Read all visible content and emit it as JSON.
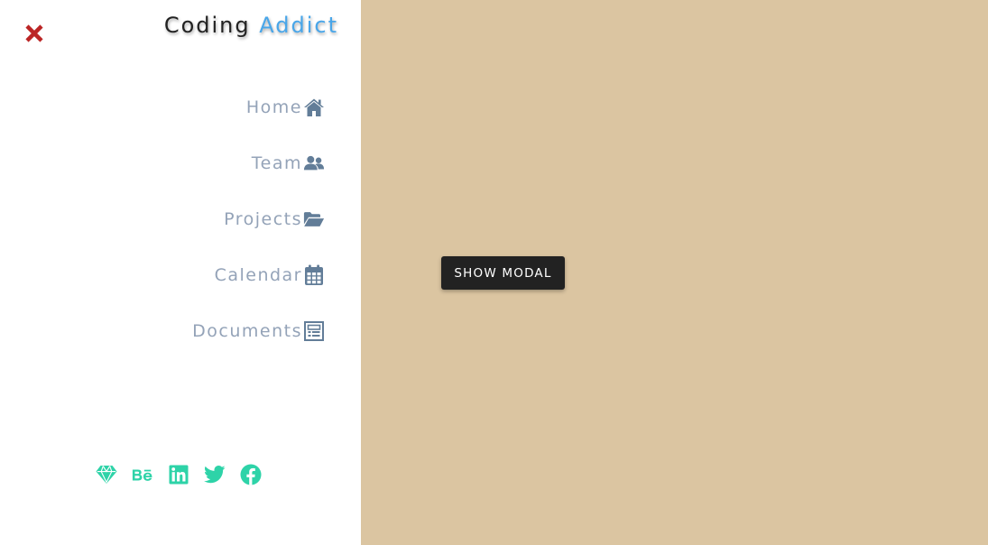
{
  "colors": {
    "main_background": "#dbc5a1",
    "sidebar_background": "#ffffff",
    "accent_blue": "#49a6e9",
    "close_red": "#bb2525",
    "nav_text": "#94a3b8",
    "nav_icon": "#627d98",
    "social_green": "#2ed3a8",
    "button_dark": "#222222"
  },
  "sidebar": {
    "close_icon": "close-icon",
    "logo": {
      "word1": "Coding",
      "word2": "Addict"
    },
    "nav": [
      {
        "label": "Home",
        "icon": "home-icon"
      },
      {
        "label": "Team",
        "icon": "users-icon"
      },
      {
        "label": "Projects",
        "icon": "folder-open-icon"
      },
      {
        "label": "Calendar",
        "icon": "calendar-icon"
      },
      {
        "label": "Documents",
        "icon": "document-icon"
      }
    ],
    "social": [
      {
        "icon": "sketch-icon"
      },
      {
        "icon": "behance-icon"
      },
      {
        "icon": "linkedin-icon"
      },
      {
        "icon": "twitter-icon"
      },
      {
        "icon": "facebook-icon"
      }
    ]
  },
  "main": {
    "modal_button_label": "SHOW MODAL"
  }
}
